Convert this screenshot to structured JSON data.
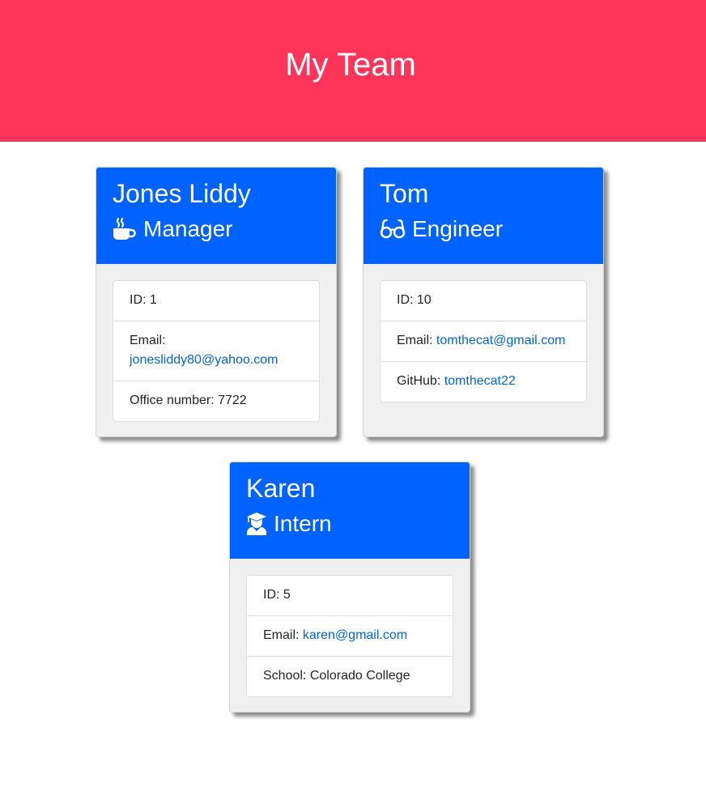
{
  "header": {
    "title": "My Team"
  },
  "team": [
    {
      "name": "Jones Liddy",
      "role": "Manager",
      "icon": "mug-hot-icon",
      "id_label": "ID:",
      "id": "1",
      "email_label": "Email:",
      "email": "jonesliddy80@yahoo.com",
      "extra_label": "Office number:",
      "extra": "7722"
    },
    {
      "name": "Tom",
      "role": "Engineer",
      "icon": "glasses-icon",
      "id_label": "ID:",
      "id": "10",
      "email_label": "Email:",
      "email": "tomthecat@gmail.com",
      "extra_label": "GitHub:",
      "extra": "tomthecat22"
    },
    {
      "name": "Karen",
      "role": "Intern",
      "icon": "user-graduate-icon",
      "id_label": "ID:",
      "id": "5",
      "email_label": "Email:",
      "email": "karen@gmail.com",
      "extra_label": "School:",
      "extra": "Colorado College"
    }
  ],
  "colors": {
    "header_bg": "#ff3459",
    "card_header_bg": "#0062ff",
    "card_body_bg": "#f0f0f0",
    "link": "#0066e6"
  }
}
